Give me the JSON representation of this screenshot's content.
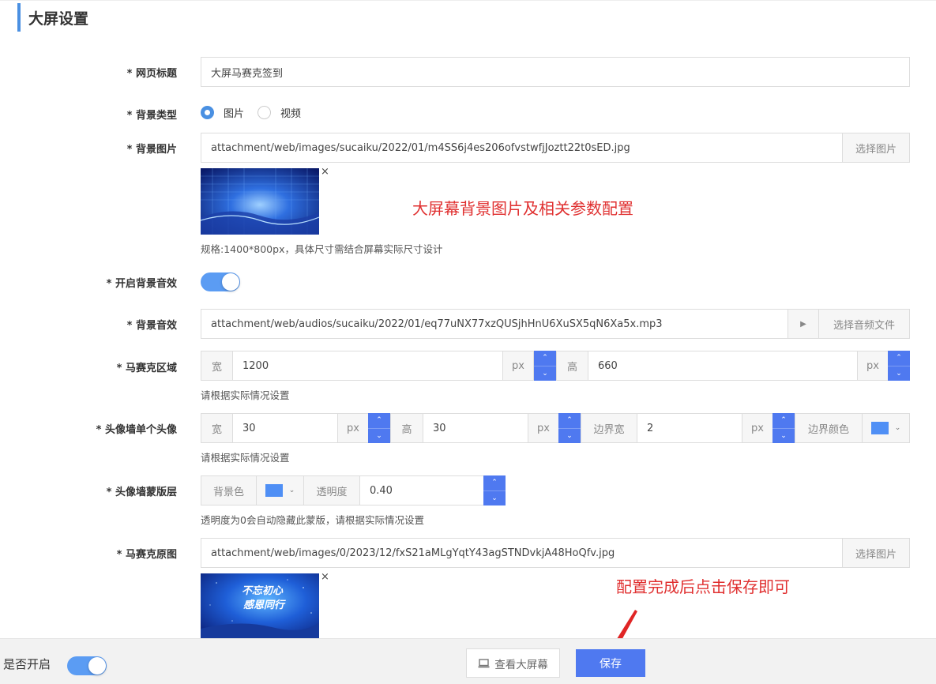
{
  "page": {
    "section_title": "大屏设置"
  },
  "form": {
    "page_title": {
      "label": "* 网页标题",
      "value": "大屏马赛克签到"
    },
    "bg_type": {
      "label": "* 背景类型",
      "options": [
        "图片",
        "视频"
      ],
      "selected": "图片"
    },
    "bg_image": {
      "label": "* 背景图片",
      "value": "attachment/web/images/sucaiku/2022/01/m4SS6j4es206ofvstwfjJoztt22t0sED.jpg",
      "button": "选择图片",
      "hint": "规格:1400*800px，具体尺寸需结合屏幕实际尺寸设计"
    },
    "bg_audio_enable": {
      "label": "* 开启背景音效",
      "on": true
    },
    "bg_audio": {
      "label": "* 背景音效",
      "value": "attachment/web/audios/sucaiku/2022/01/eq77uNX77xzQUSjhHnU6XuSX5qN6Xa5x.mp3",
      "play_icon": "▶",
      "button": "选择音频文件"
    },
    "mosaic_area": {
      "label": "* 马赛克区域",
      "width_label": "宽",
      "width": "1200",
      "height_label": "高",
      "height": "660",
      "unit": "px",
      "hint": "请根据实际情况设置"
    },
    "avatar": {
      "label": "* 头像墙单个头像",
      "width_label": "宽",
      "width": "30",
      "height_label": "高",
      "height": "30",
      "border_label": "边界宽",
      "border": "2",
      "unit": "px",
      "border_color_label": "边界颜色",
      "border_color": "#4f8ff5",
      "hint": "请根据实际情况设置"
    },
    "overlay": {
      "label": "* 头像墙蒙版层",
      "bg_label": "背景色",
      "bg_color": "#4f8ff5",
      "opacity_label": "透明度",
      "opacity": "0.40",
      "hint": "透明度为0会自动隐藏此蒙版，请根据实际情况设置"
    },
    "mosaic_image": {
      "label": "* 马赛克原图",
      "value": "attachment/web/images/0/2023/12/fxS21aMLgYqtY43agSTNDvkjA48HoQfv.jpg",
      "button": "选择图片"
    }
  },
  "annotations": {
    "bg_note": "大屏幕背景图片及相关参数配置",
    "save_note": "配置完成后点击保存即可"
  },
  "footer": {
    "enable_label": "是否开启",
    "enable_on": true,
    "view_button": "查看大屏幕",
    "save_button": "保存"
  },
  "icons": {
    "close": "×",
    "up": "⌃",
    "down": "⌄",
    "caret": "⌄"
  },
  "thumb2_text": {
    "line1": "不忘初心",
    "line2": "感恩同行"
  },
  "colors": {
    "accent": "#4f79f0",
    "annotation": "#e03030",
    "section_bar": "#4a90e2"
  }
}
